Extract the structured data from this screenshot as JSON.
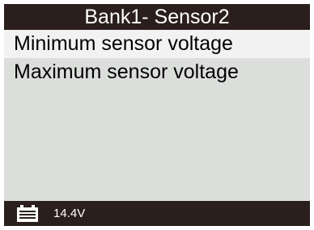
{
  "header": {
    "title": "Bank1- Sensor2"
  },
  "menu": {
    "items": [
      {
        "label": "Minimum sensor voltage",
        "selected": true
      },
      {
        "label": "Maximum sensor voltage",
        "selected": false
      }
    ]
  },
  "status_bar": {
    "battery_icon": "battery-icon",
    "voltage": "14.4V"
  },
  "colors": {
    "bar_background": "#2a1f1c",
    "screen_background": "#dbdedb",
    "selected_row": "#f2f2f2"
  }
}
